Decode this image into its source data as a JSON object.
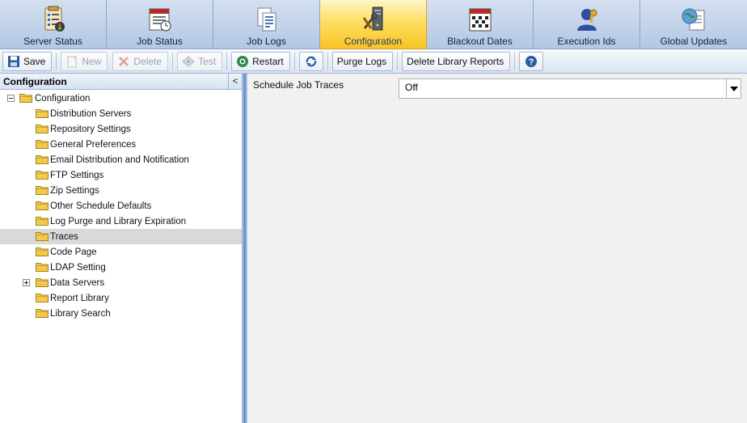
{
  "tabs": [
    {
      "label": "Server Status",
      "icon": "server-status-icon",
      "active": false
    },
    {
      "label": "Job Status",
      "icon": "job-status-icon",
      "active": false
    },
    {
      "label": "Job Logs",
      "icon": "job-logs-icon",
      "active": false
    },
    {
      "label": "Configuration",
      "icon": "configuration-icon",
      "active": true
    },
    {
      "label": "Blackout Dates",
      "icon": "calendar-icon",
      "active": false
    },
    {
      "label": "Execution Ids",
      "icon": "user-key-icon",
      "active": false
    },
    {
      "label": "Global Updates",
      "icon": "globe-document-icon",
      "active": false
    }
  ],
  "toolbar": {
    "save": "Save",
    "new": "New",
    "delete": "Delete",
    "test": "Test",
    "restart": "Restart",
    "purge_logs": "Purge Logs",
    "delete_library_reports": "Delete Library Reports"
  },
  "panel": {
    "title": "Configuration",
    "collapse": "<"
  },
  "tree": {
    "root": "Configuration",
    "items": [
      "Distribution Servers",
      "Repository Settings",
      "General Preferences",
      "Email Distribution and Notification",
      "FTP Settings",
      "Zip Settings",
      "Other Schedule Defaults",
      "Log Purge and Library Expiration",
      "Traces",
      "Code Page",
      "LDAP Setting",
      "Data Servers",
      "Report Library",
      "Library Search"
    ],
    "selected": "Traces",
    "expandable": "Data Servers"
  },
  "content": {
    "field_label": "Schedule Job Traces",
    "field_value": "Off"
  },
  "colors": {
    "active_tab": "#ffde62",
    "tab_bg": "#b4c6e0",
    "selected_row": "#d9d9d9",
    "folder": "#f2c94c"
  }
}
